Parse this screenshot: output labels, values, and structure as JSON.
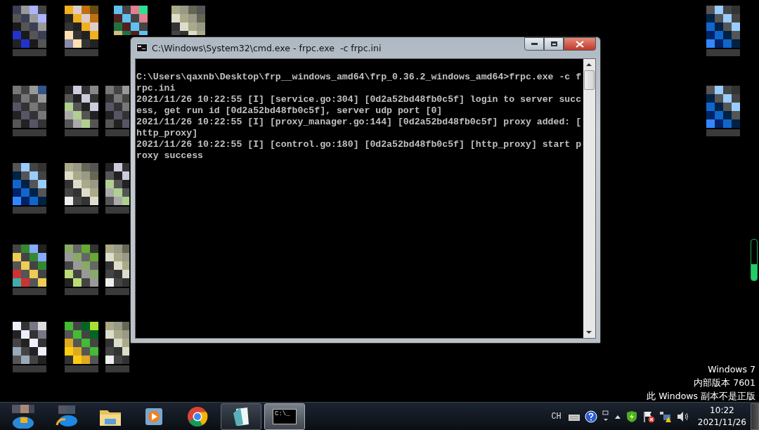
{
  "window": {
    "title": "C:\\Windows\\System32\\cmd.exe - frpc.exe  -c frpc.ini",
    "console_lines": [
      "C:\\Users\\qaxnb\\Desktop\\frp__windows_amd64\\frp_0.36.2_windows_amd64>frpc.exe -c f",
      "rpc.ini",
      "2021/11/26 10:22:55 [I] [service.go:304] [0d2a52bd48fb0c5f] login to server succ",
      "ess, get run id [0d2a52bd48fb0c5f], server udp port [0]",
      "2021/11/26 10:22:55 [I] [proxy_manager.go:144] [0d2a52bd48fb0c5f] proxy added: [",
      "http_proxy]",
      "2021/11/26 10:22:55 [I] [control.go:180] [0d2a52bd48fb0c5f] [http_proxy] start p",
      "roxy success"
    ]
  },
  "activation_notice": [
    "Windows 7",
    "内部版本 7601",
    "此 Windows 副本不是正版"
  ],
  "taskbar": {
    "buttons": [
      {
        "kind": "start",
        "open": false,
        "selected": false
      },
      {
        "kind": "browser-e",
        "open": false,
        "selected": false
      },
      {
        "kind": "folder",
        "open": false,
        "selected": false
      },
      {
        "kind": "player",
        "open": false,
        "selected": false
      },
      {
        "kind": "chrome",
        "open": false,
        "selected": false
      },
      {
        "kind": "notepad",
        "open": true,
        "selected": false
      },
      {
        "kind": "console",
        "open": true,
        "selected": true
      }
    ],
    "console_icon_text": "C:\\_",
    "tray": {
      "language": "CH",
      "time": "10:22",
      "date": "2021/11/26"
    }
  }
}
